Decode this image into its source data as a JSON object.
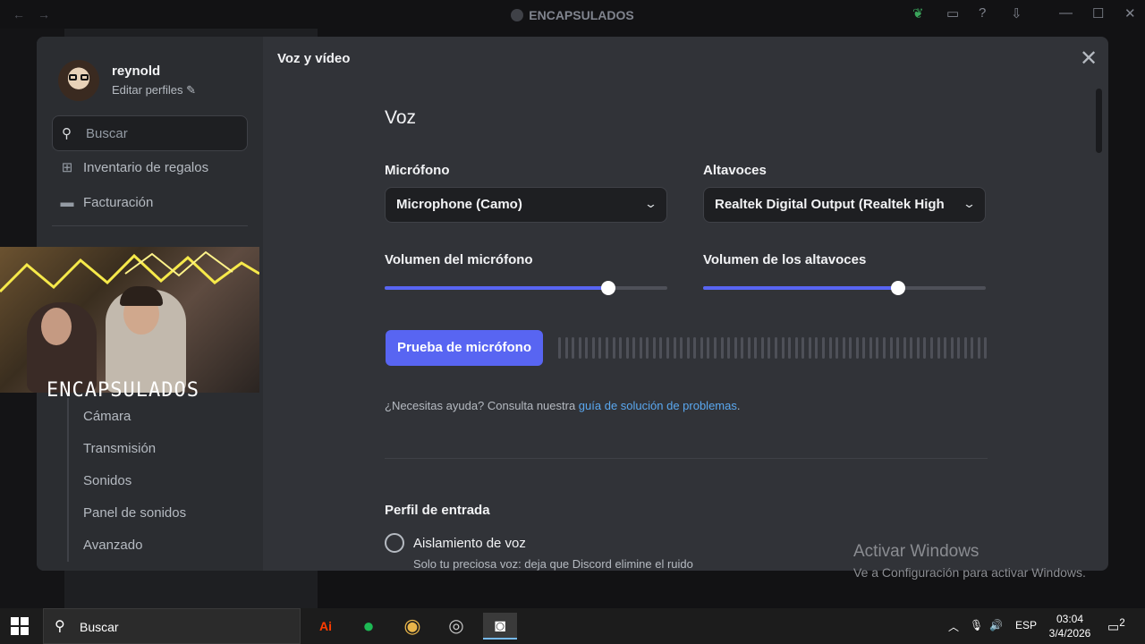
{
  "window": {
    "title": "ENCAPSULADOS",
    "back": "←",
    "forward": "→",
    "minimize": "—",
    "maximize": "☐",
    "close": "✕"
  },
  "user": {
    "name": "reynold",
    "edit_profiles": "Editar perfiles ✎"
  },
  "sidebar": {
    "search_placeholder": "Buscar",
    "items": [
      {
        "label": "Inventario de regalos",
        "icon": "gift-icon"
      },
      {
        "label": "Facturación",
        "icon": "billing-card-icon"
      }
    ],
    "voice_subitems": [
      "Cámara",
      "Transmisión",
      "Sonidos",
      "Panel de sonidos",
      "Avanzado"
    ]
  },
  "page": {
    "title": "Voz y vídeo",
    "section": "Voz",
    "microphone_label": "Micrófono",
    "microphone_value": "Microphone (Camo)",
    "speakers_label": "Altavoces",
    "speakers_value": "Realtek Digital Output (Realtek High D",
    "mic_volume_label": "Volumen del micrófono",
    "mic_volume": 0.79,
    "speaker_volume_label": "Volumen de los altavoces",
    "speaker_volume": 0.69,
    "test_button": "Prueba de micrófono",
    "help_text": "¿Necesitas ayuda? Consulta nuestra ",
    "help_link": "guía de solución de problemas",
    "help_end": ".",
    "input_profile_label": "Perfil de entrada",
    "voice_isolation_label": "Aislamiento de voz",
    "voice_isolation_desc": "Solo tu preciosa voz: deja que Discord elimine el ruido"
  },
  "overlay": {
    "webcam_logo": "ENCAPSULADOS"
  },
  "watermark": {
    "line1": "Activar Windows",
    "line2": "Ve a Configuración para activar Windows."
  },
  "taskbar": {
    "search": "Buscar",
    "language": "ESP",
    "time": "03:04",
    "date": "3/4/2026",
    "notification_count": "2"
  },
  "colors": {
    "accent": "#5865f2",
    "link": "#5aa8f0",
    "modal_bg": "#313338",
    "sidebar_bg": "#2b2d31"
  }
}
